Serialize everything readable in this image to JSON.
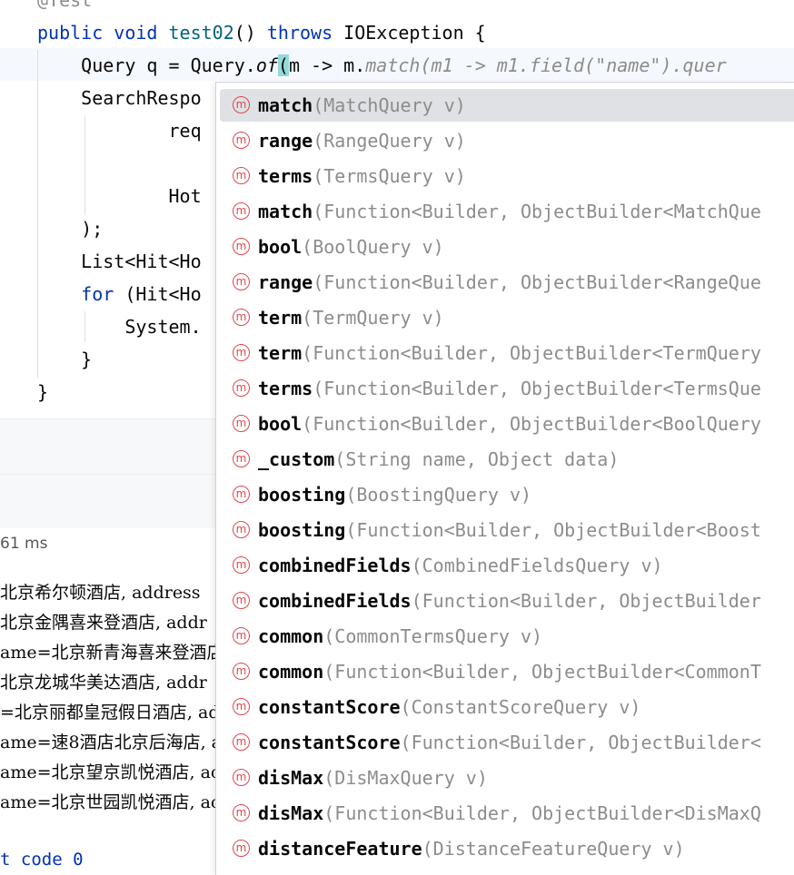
{
  "editor": {
    "annotation": "@Test",
    "lines": {
      "l1": {
        "kw1": "public",
        "kw2": "void",
        "fn": "test02",
        "rest1": "() ",
        "kw3": "throws",
        "rest2": " IOException {"
      },
      "l2": {
        "pre": "    Query q = Query.",
        "of": "of",
        "paren": "(",
        "mid": "m -> m.",
        "match": "match",
        "rest": "(m1 -> m1.",
        "field": "field",
        "str": "(\"name\").quer"
      },
      "l3": "    SearchRespo",
      "l4": "            req",
      "l5": "            Hot",
      "l6": "    );",
      "l7": "    List<Hit<Ho",
      "l8": {
        "kw": "for",
        "rest": " (Hit<Ho"
      },
      "l9": "        System.",
      "l10": "    }",
      "l11": "}"
    }
  },
  "run": {
    "timing": "61 ms",
    "output": [
      "北京希尔顿酒店, address",
      "北京金隅喜来登酒店, addr",
      "ame=北京新青海喜来登酒店",
      "北京龙城华美达酒店, addr",
      "=北京丽都皇冠假日酒店, ad",
      "ame=速8酒店北京后海店, a",
      "ame=北京望京凯悦酒店, ac",
      "ame=北京世园凯悦酒店, ac"
    ],
    "exit": "t code 0"
  },
  "completion": {
    "icon_letter": "m",
    "items": [
      {
        "name": "match",
        "params": "(MatchQuery v)"
      },
      {
        "name": "range",
        "params": "(RangeQuery v)"
      },
      {
        "name": "terms",
        "params": "(TermsQuery v)"
      },
      {
        "name": "match",
        "params": "(Function<Builder, ObjectBuilder<MatchQue"
      },
      {
        "name": "bool",
        "params": "(BoolQuery v)"
      },
      {
        "name": "range",
        "params": "(Function<Builder, ObjectBuilder<RangeQue"
      },
      {
        "name": "term",
        "params": "(TermQuery v)"
      },
      {
        "name": "term",
        "params": "(Function<Builder, ObjectBuilder<TermQuery"
      },
      {
        "name": "terms",
        "params": "(Function<Builder, ObjectBuilder<TermsQue"
      },
      {
        "name": "bool",
        "params": "(Function<Builder, ObjectBuilder<BoolQuery"
      },
      {
        "name": "_custom",
        "params": "(String name, Object data)"
      },
      {
        "name": "boosting",
        "params": "(BoostingQuery v)"
      },
      {
        "name": "boosting",
        "params": "(Function<Builder, ObjectBuilder<Boost"
      },
      {
        "name": "combinedFields",
        "params": "(CombinedFieldsQuery v)"
      },
      {
        "name": "combinedFields",
        "params": "(Function<Builder, ObjectBuilder"
      },
      {
        "name": "common",
        "params": "(CommonTermsQuery v)"
      },
      {
        "name": "common",
        "params": "(Function<Builder, ObjectBuilder<CommonT"
      },
      {
        "name": "constantScore",
        "params": "(ConstantScoreQuery v)"
      },
      {
        "name": "constantScore",
        "params": "(Function<Builder, ObjectBuilder<"
      },
      {
        "name": "disMax",
        "params": "(DisMaxQuery v)"
      },
      {
        "name": "disMax",
        "params": "(Function<Builder, ObjectBuilder<DisMaxQ"
      },
      {
        "name": "distanceFeature",
        "params": "(DistanceFeatureQuery v)"
      }
    ]
  }
}
